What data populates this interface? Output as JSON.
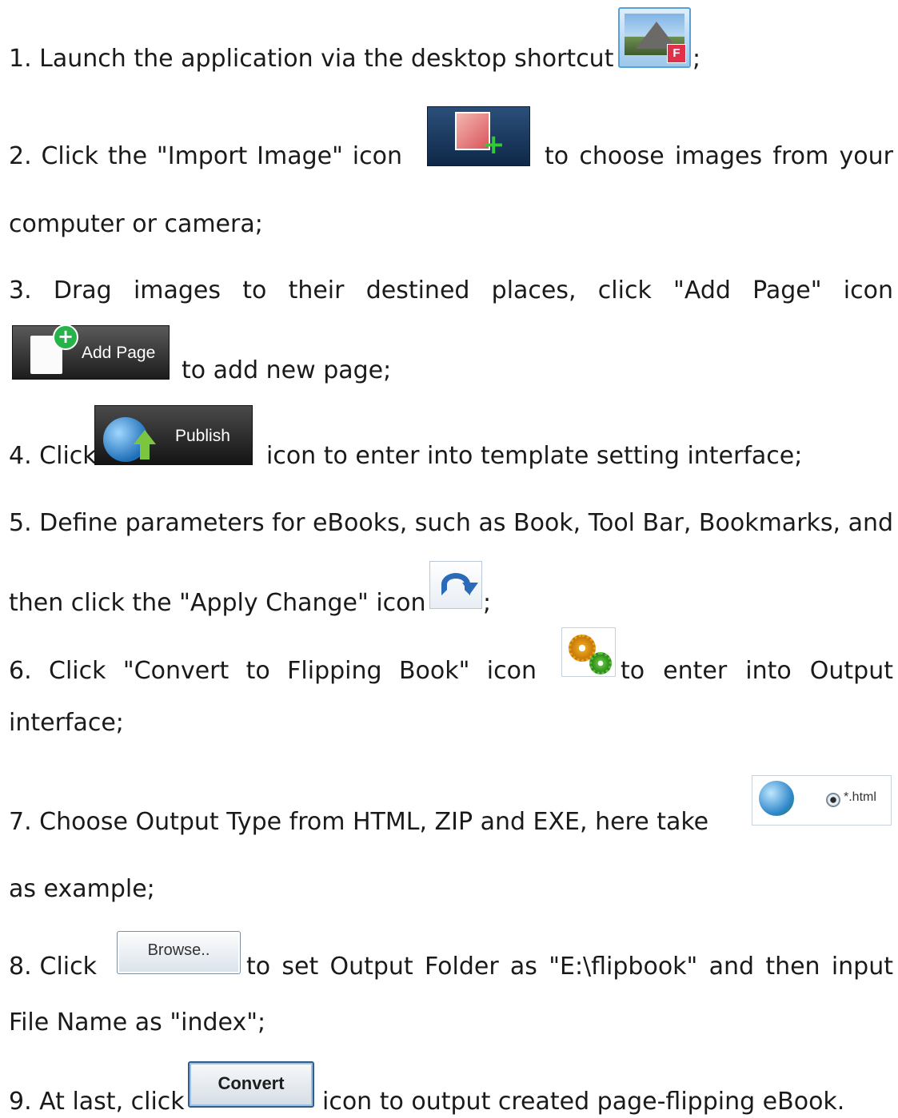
{
  "steps": {
    "s1": {
      "before": "1. Launch the application via the desktop shortcut",
      "after": ";"
    },
    "s2": {
      "w": [
        "2.",
        "Click",
        "the",
        "\"Import",
        "Image\"",
        "icon"
      ],
      "w_after": [
        "to",
        "choose",
        "images",
        "from",
        "your"
      ],
      "line2": "computer or camera;"
    },
    "s3": {
      "w": [
        "3.",
        "Drag",
        "images",
        "to",
        "their",
        "destined",
        "places,",
        "click",
        "\"Add",
        "Page\"",
        "icon"
      ],
      "line2": "to add new page;"
    },
    "s4": {
      "before": "4. Click",
      "after": "icon to enter into template setting interface;"
    },
    "s5": {
      "line1": "5. Define parameters for eBooks, such as Book, Tool Bar, Bookmarks, and",
      "before": "then click the \"Apply Change\" icon",
      "after": ";"
    },
    "s6": {
      "w": [
        "6.",
        "Click",
        "\"Convert",
        "to",
        "Flipping",
        "Book\"",
        "icon"
      ],
      "w_after": [
        "to",
        "enter",
        "into",
        "Output"
      ],
      "line2": "interface;"
    },
    "s7": {
      "line1": "7. Choose Output Type from HTML, ZIP and EXE, here take",
      "line2": "as example;"
    },
    "s8": {
      "w": [
        "8.",
        "Click"
      ],
      "w_after": [
        "to",
        "set",
        "Output",
        "Folder",
        "as",
        "\"E:\\flipbook\"",
        "and",
        "then",
        "input"
      ],
      "line2": "File Name as \"index\";"
    },
    "s9": {
      "before": "9. At last, click",
      "after": "icon to output created page-flipping eBook."
    }
  },
  "icons": {
    "shortcut": {
      "name": "desktop-shortcut-icon",
      "badge": "F"
    },
    "import_image": {
      "name": "import-image-icon"
    },
    "add_page": {
      "name": "add-page-icon",
      "label": "Add Page"
    },
    "publish": {
      "name": "publish-icon",
      "label": "Publish"
    },
    "apply_change": {
      "name": "apply-change-icon"
    },
    "convert_book": {
      "name": "gears-icon"
    },
    "html_option": {
      "name": "globe-icon",
      "label": "*.html"
    },
    "browse": {
      "name": "browse-button",
      "label": "Browse.."
    },
    "convert": {
      "name": "convert-button",
      "label": "Convert"
    }
  },
  "colors": {
    "text": "#1a1a1a",
    "accent_blue": "#2a6ab8",
    "green": "#34c93b"
  }
}
